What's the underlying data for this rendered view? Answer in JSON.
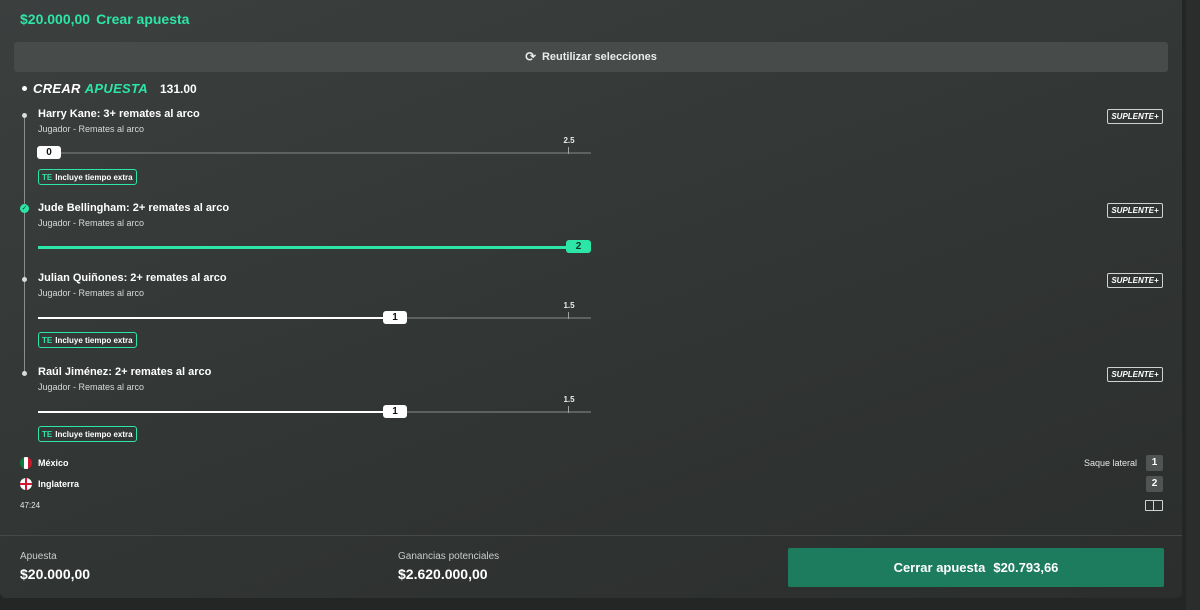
{
  "header": {
    "stake": "$20.000,00",
    "label": "Crear apuesta"
  },
  "reuse_button": {
    "icon": "refresh-icon",
    "label": "Reutilizar selecciones"
  },
  "bet_builder": {
    "word1": "CREAR",
    "word2": "APUESTA",
    "odds": "131.00"
  },
  "legs": [
    {
      "title": "Harry Kane: 3+ remates al arco",
      "subtitle": "Jugador - Remates al arco",
      "badge": "SUPLENTE+",
      "current": "0",
      "target": "2.5",
      "progress": 0,
      "extra_time": {
        "code": "TE",
        "label": "Incluye tiempo extra"
      },
      "won": false
    },
    {
      "title": "Jude Bellingham: 2+ remates al arco",
      "subtitle": "Jugador - Remates al arco",
      "badge": "SUPLENTE+",
      "current": "2",
      "target": "",
      "progress": 1.0,
      "won": true
    },
    {
      "title": "Julian Quiñones: 2+ remates al arco",
      "subtitle": "Jugador - Remates al arco",
      "badge": "SUPLENTE+",
      "current": "1",
      "target": "1.5",
      "progress": 0.667,
      "extra_time": {
        "code": "TE",
        "label": "Incluye tiempo extra"
      },
      "won": false
    },
    {
      "title": "Raúl Jiménez: 2+ remates al arco",
      "subtitle": "Jugador - Remates al arco",
      "badge": "SUPLENTE+",
      "current": "1",
      "target": "1.5",
      "progress": 0.667,
      "extra_time": {
        "code": "TE",
        "label": "Incluye tiempo extra"
      },
      "won": false
    }
  ],
  "match": {
    "teams": [
      {
        "name": "México",
        "flag": "mexico-flag-icon",
        "stat": "1"
      },
      {
        "name": "Inglaterra",
        "flag": "england-flag-icon",
        "stat": "2"
      }
    ],
    "stat_label": "Saque lateral",
    "clock": "47:24"
  },
  "footer": {
    "stake_label": "Apuesta",
    "stake_value": "$20.000,00",
    "winnings_label": "Ganancias potenciales",
    "winnings_value": "$2.620.000,00",
    "cashout_label": "Cerrar apuesta",
    "cashout_value": "$20.793,66"
  },
  "colors": {
    "accent": "#2ce6a8",
    "cashout_bg": "#1d7b5e",
    "panel": "#363a39"
  }
}
